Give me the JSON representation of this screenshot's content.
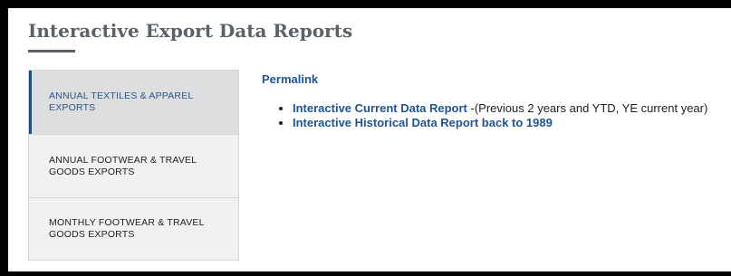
{
  "page": {
    "title": "Interactive Export Data Reports"
  },
  "tabs": [
    {
      "label": "ANNUAL TEXTILES & APPAREL EXPORTS",
      "active": true
    },
    {
      "label": "ANNUAL FOOTWEAR & TRAVEL GOODS EXPORTS",
      "active": false
    },
    {
      "label": "MONTHLY FOOTWEAR & TRAVEL GOODS EXPORTS",
      "active": false
    }
  ],
  "content": {
    "permalink_label": "Permalink",
    "reports": [
      {
        "link_text": "Interactive Current Data Report",
        "description": "-(Previous 2 years and YTD, YE current year)"
      },
      {
        "link_text": "Interactive Historical Data Report back to 1989",
        "description": ""
      }
    ]
  },
  "colors": {
    "link": "#205493",
    "title": "#5b616b",
    "active_tab_bg": "#dcdee0",
    "tab_bg": "#f1f1f1",
    "active_tab_text": "#2e5486"
  }
}
